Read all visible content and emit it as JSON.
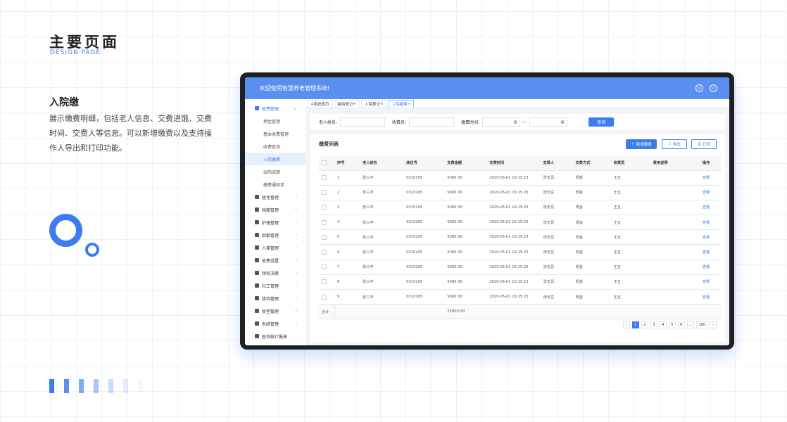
{
  "page": {
    "title": "主要页面",
    "subtitle": "DESIGN PAGE"
  },
  "section": {
    "title": "入院缴",
    "description": "展示缴费明细，包括老人信息、交费进饿、交费时间、交费人等信息。可以新增缴费以及支持操作人导出和打印功能。"
  },
  "app": {
    "welcome": "欢迎使用智慧养老管理系统!"
  },
  "sidebar": {
    "open_menu": "收费管理",
    "sub_items": [
      "押金管理",
      "基本收费管理",
      "收费查询",
      "入院缴费",
      "出院结算",
      "缴费通知单"
    ],
    "active_sub": "入院缴费",
    "menus": [
      "居住管理",
      "档案管理",
      "护理管理",
      "后勤管理",
      "人事管理",
      "收费设置",
      "领导决策",
      "社工管理",
      "接待管理",
      "食堂管理",
      "系统管理",
      "查询统计报表"
    ]
  },
  "tabs": [
    "系统首页",
    "接待登记",
    "入院登记",
    "入院缴费"
  ],
  "active_tab": "入院缴费",
  "filter": {
    "name_label": "老人姓名:",
    "collector_label": "收费员:",
    "time_label": "缴费时间:",
    "range_sep": "—",
    "query": "查询"
  },
  "panel": {
    "title": "缴费列表",
    "add": "新增缴费",
    "export": "导出",
    "print": "打印"
  },
  "table": {
    "headers": [
      "序号",
      "老人姓名",
      "床位号",
      "交费金额",
      "交费时间",
      "交费人",
      "交费方式",
      "收费员",
      "费用说明",
      "操作"
    ],
    "rows": [
      [
        "1",
        "张三丰",
        "0310105",
        "9000.00",
        "2020-05-01 16:15:23",
        "张无忌",
        "现金",
        "王五",
        "",
        "查看"
      ],
      [
        "2",
        "张三丰",
        "0310105",
        "9000.00",
        "2020-05-01 16:15:23",
        "张无忌",
        "现金",
        "王五",
        "",
        "查看"
      ],
      [
        "3",
        "张三丰",
        "0310105",
        "9000.00",
        "2020-05-01 16:15:23",
        "张无忌",
        "现金",
        "王五",
        "",
        "查看"
      ],
      [
        "4",
        "张三丰",
        "0310105",
        "9000.00",
        "2020-05-01 16:15:23",
        "张无忌",
        "现金",
        "王五",
        "",
        "查看"
      ],
      [
        "5",
        "张三丰",
        "0310105",
        "9000.00",
        "2020-05-01 16:15:23",
        "张无忌",
        "现金",
        "王五",
        "",
        "查看"
      ],
      [
        "6",
        "张三丰",
        "0310105",
        "9000.00",
        "2020-05-01 16:15:23",
        "张无忌",
        "现金",
        "王五",
        "",
        "查看"
      ],
      [
        "7",
        "张三丰",
        "0310105",
        "9000.00",
        "2020-05-01 16:15:23",
        "张无忌",
        "现金",
        "王五",
        "",
        "查看"
      ],
      [
        "8",
        "张三丰",
        "0310105",
        "9000.00",
        "2020-05-01 16:15:23",
        "张无忌",
        "现金",
        "王五",
        "",
        "查看"
      ],
      [
        "9",
        "张三丰",
        "0310105",
        "9000.00",
        "2020-05-01 16:15:23",
        "张无忌",
        "现金",
        "王五",
        "",
        "查看"
      ]
    ],
    "sum_label": "合计",
    "sum_value": "25000.00"
  },
  "pagination": {
    "prev": "‹",
    "pages": [
      "1",
      "2",
      "3",
      "4",
      "5",
      "6",
      "...",
      "100"
    ],
    "active": "1",
    "next": "›"
  },
  "colors": {
    "accent": "#3d7cf0",
    "topbar": "#5b8fef"
  }
}
